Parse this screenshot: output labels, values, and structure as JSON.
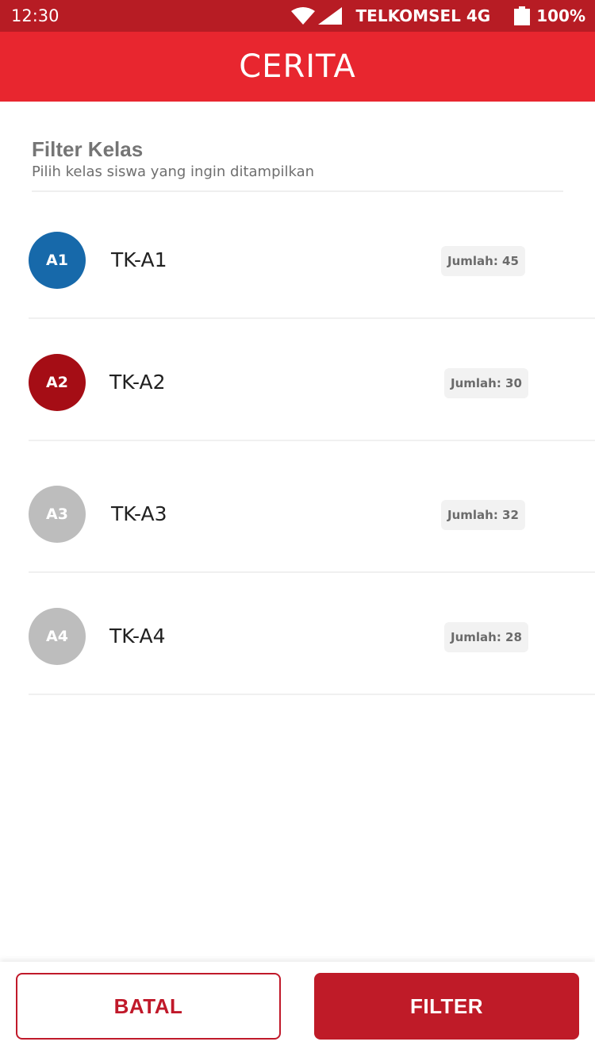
{
  "status_bar": {
    "time": "12:30",
    "carrier": "TELKOMSEL 4G",
    "battery": "100%"
  },
  "app_bar": {
    "title": "CERITA"
  },
  "filter": {
    "title": "Filter Kelas",
    "subtitle": "Pilih kelas siswa yang ingin ditampilkan"
  },
  "classes": [
    {
      "badge": "A1",
      "name": "TK-A1",
      "count_label": "Jumlah: 45",
      "color": "#1769aa",
      "selected": true
    },
    {
      "badge": "A2",
      "name": "TK-A2",
      "count_label": "Jumlah: 30",
      "color": "#a50d15",
      "selected": true
    },
    {
      "badge": "A3",
      "name": "TK-A3",
      "count_label": "Jumlah: 32",
      "color": "#bdbdbd",
      "selected": false
    },
    {
      "badge": "A4",
      "name": "TK-A4",
      "count_label": "Jumlah: 28",
      "color": "#bdbdbd",
      "selected": false
    }
  ],
  "actions": {
    "cancel_label": "BATAL",
    "filter_label": "FILTER"
  },
  "colors": {
    "status_bar": "#b71c24",
    "app_bar": "#e8262f",
    "primary_button": "#bf1b28"
  }
}
